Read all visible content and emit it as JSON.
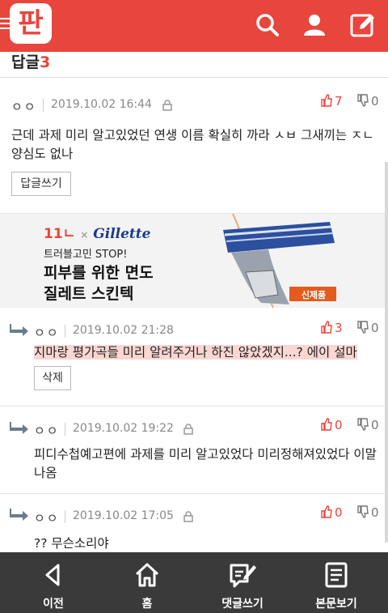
{
  "header": {
    "logo": "판",
    "search_icon": "search-icon",
    "user_icon": "user-icon",
    "write_icon": "write-icon"
  },
  "replies": {
    "label": "답글",
    "count": "3"
  },
  "comments": [
    {
      "author": "ㅇㅇ",
      "date": "2019.10.02 16:44",
      "up": "7",
      "down": "0",
      "text": "근데 과제 미리 알고있었던 연생 이름 확실히 까라 ㅅㅂ 그새끼는 ㅈㄴ 양심도 없나",
      "button": "답글쓰기"
    },
    {
      "author": "ㅇㅇ",
      "date": "2019.10.02 21:28",
      "up": "3",
      "down": "0",
      "text": "지마랑 평가곡들 미리 알려주거나 하진 않았겠지...? 에이 설마",
      "button": "삭제"
    },
    {
      "author": "ㅇㅇ",
      "date": "2019.10.02 19:22",
      "up": "0",
      "down": "0",
      "text": "피디수첩예고편에 과제를 미리 알고있었다 미리정해져있었다 이말 나옴"
    },
    {
      "author": "ㅇㅇ",
      "date": "2019.10.02 17:05",
      "up": "0",
      "down": "0",
      "text": "?? 무슨소리야"
    }
  ],
  "ad": {
    "brand_left": "11ㄴ",
    "brand_x": "×",
    "brand_right": "Gillette",
    "tagline": "트러블고민 STOP!",
    "headline1": "피부를 위한 면도",
    "headline2": "질레트 스킨텍",
    "badge": "신제품"
  },
  "nav": {
    "prev": "이전",
    "home": "홈",
    "write_reply": "댓글쓰기",
    "view_post": "본문보기"
  },
  "colors": {
    "brand_red": "#e8453c",
    "nav_bg": "#3a3a3a",
    "highlight": "#fbd6d2"
  }
}
